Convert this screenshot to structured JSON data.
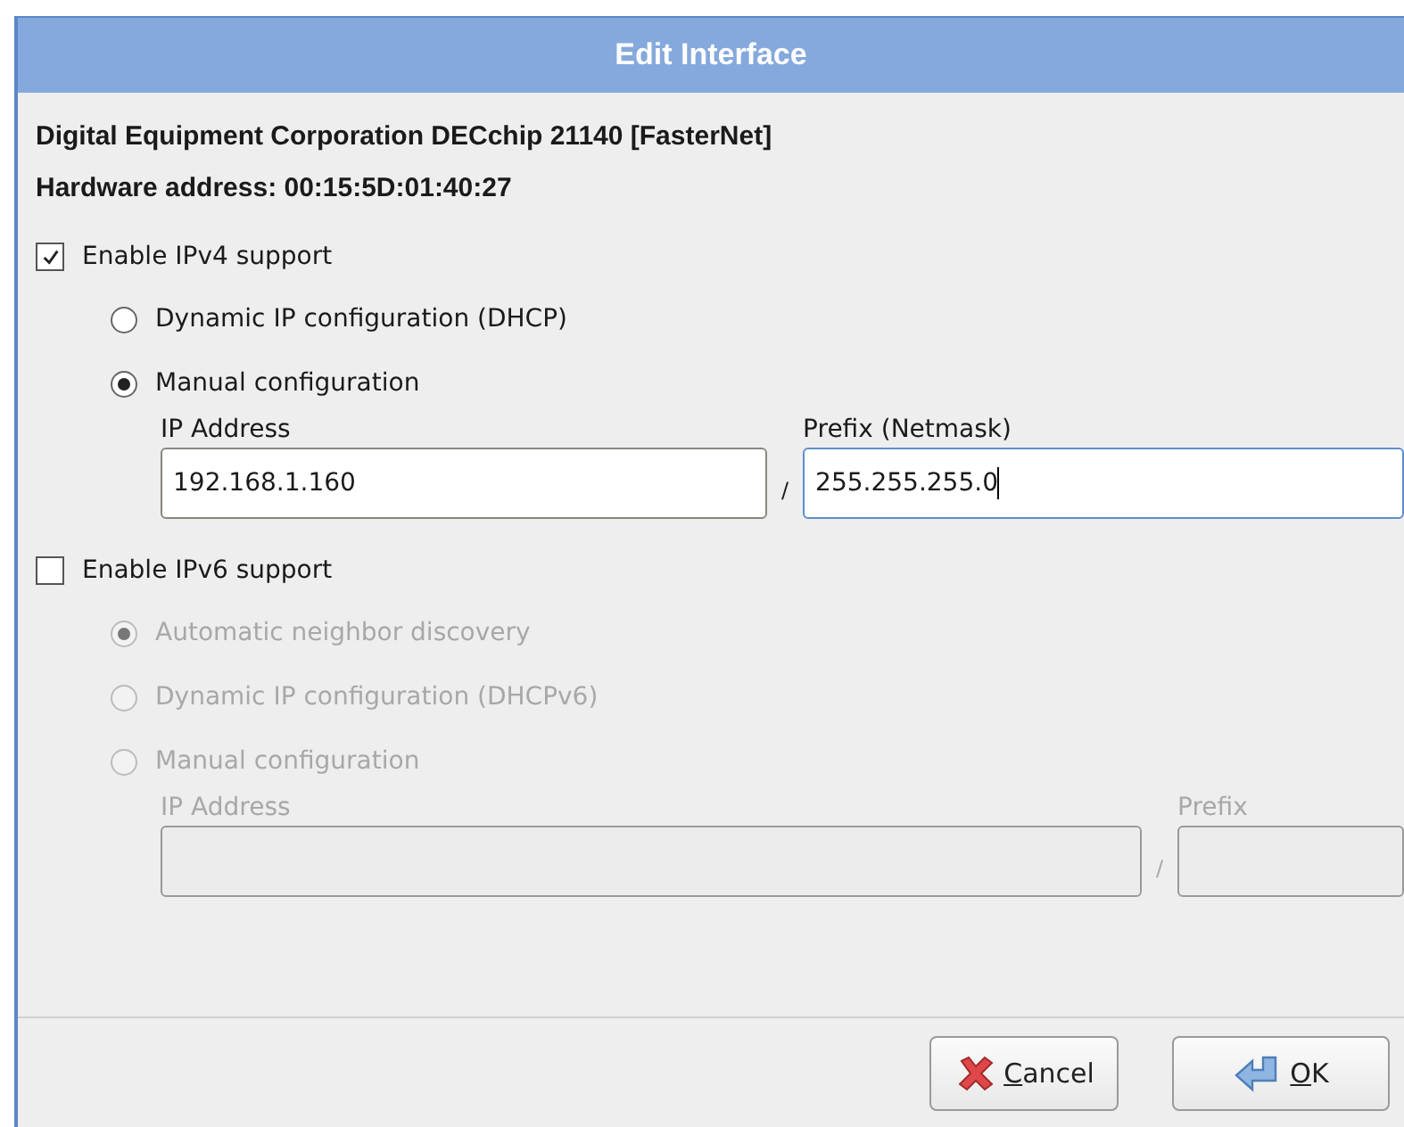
{
  "window": {
    "title": "Edit Interface"
  },
  "device": "Digital Equipment Corporation DECchip 21140 [FasterNet]",
  "hardware_address": "Hardware address: 00:15:5D:01:40:27",
  "sections": [
    {
      "label": "Enable IPv4 support",
      "checked": true,
      "options": [
        {
          "label": "Dynamic IP configuration (DHCP)",
          "selected": false
        },
        {
          "label": "Manual configuration",
          "selected": true
        }
      ],
      "fields": [
        {
          "label": "IP Address",
          "value": "192.168.1.160",
          "focused": false
        },
        {
          "label": "Prefix (Netmask)",
          "value": "255.255.255.0",
          "focused": true
        }
      ],
      "separator": "/"
    },
    {
      "label": "Enable IPv6 support",
      "checked": false,
      "options": [
        {
          "label": "Automatic neighbor discovery",
          "selected": true
        },
        {
          "label": "Dynamic IP configuration (DHCPv6)",
          "selected": false
        },
        {
          "label": "Manual configuration",
          "selected": false
        }
      ],
      "fields": [
        {
          "label": "IP Address",
          "focused": false
        },
        {
          "label": "Prefix",
          "focused": false
        }
      ],
      "separator": "/"
    }
  ],
  "buttons": [
    {
      "kind": "cancel",
      "mnemonic": "C",
      "rest": "ancel"
    },
    {
      "kind": "ok",
      "mnemonic": "O",
      "rest": "K"
    }
  ]
}
